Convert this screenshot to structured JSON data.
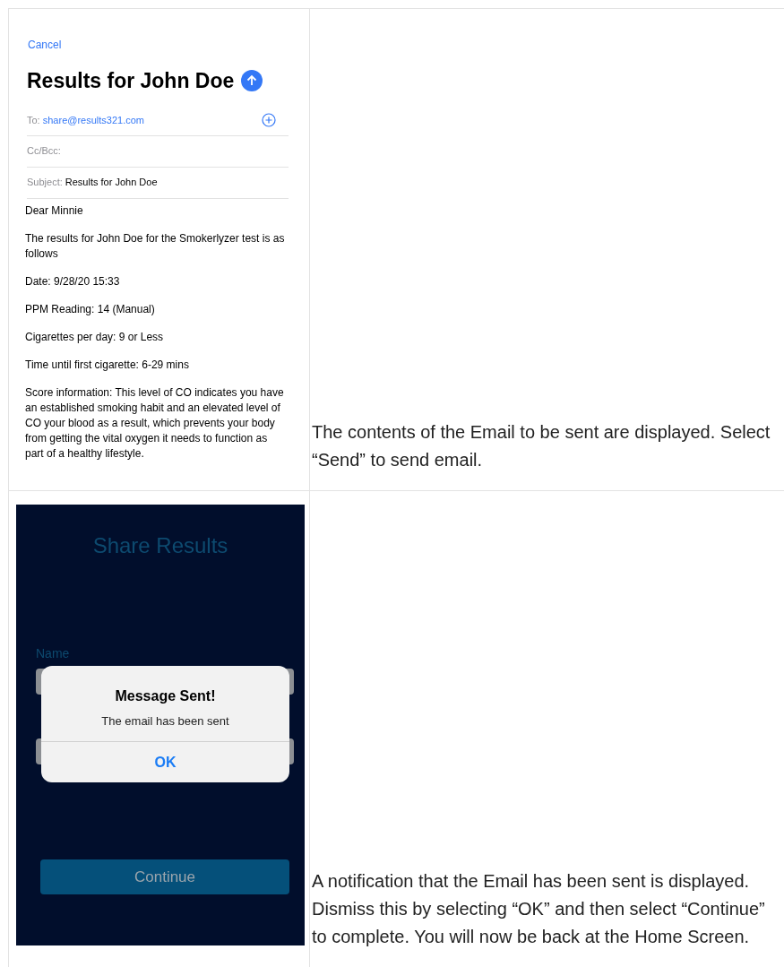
{
  "rows": [
    {
      "screen": {
        "kind": "email_compose",
        "cancel": "Cancel",
        "title": "Results for John Doe",
        "to_label": "To:",
        "to_value": "share@results321.com",
        "cc_label": "Cc/Bcc:",
        "subject_label": "Subject:",
        "subject_value": "Results for John Doe",
        "body": [
          "Dear Minnie",
          "The results for John Doe for the Smokerlyzer test is as follows",
          "Date: 9/28/20 15:33",
          "PPM Reading: 14 (Manual)",
          "Cigarettes per day: 9 or Less",
          "Time until first cigarette: 6-29 mins",
          "Score information: This level of CO indicates you have an established smoking habit and an elevated level of CO your blood as a result, which prevents your body from getting the vital oxygen it needs to function as part of a healthy lifestyle."
        ]
      },
      "caption": "The contents of the Email to be sent are displayed. Select “Send” to send email."
    },
    {
      "screen": {
        "kind": "share_results",
        "title": "Share Results",
        "name_label": "Name",
        "continue": "Continue",
        "alert": {
          "title": "Message Sent!",
          "message": "The email has been sent",
          "button": "OK"
        }
      },
      "caption": "A notification that the Email has been sent is displayed. Dismiss this by selecting “OK” and then select “Continue” to complete. You will now be back at the Home Screen."
    }
  ]
}
